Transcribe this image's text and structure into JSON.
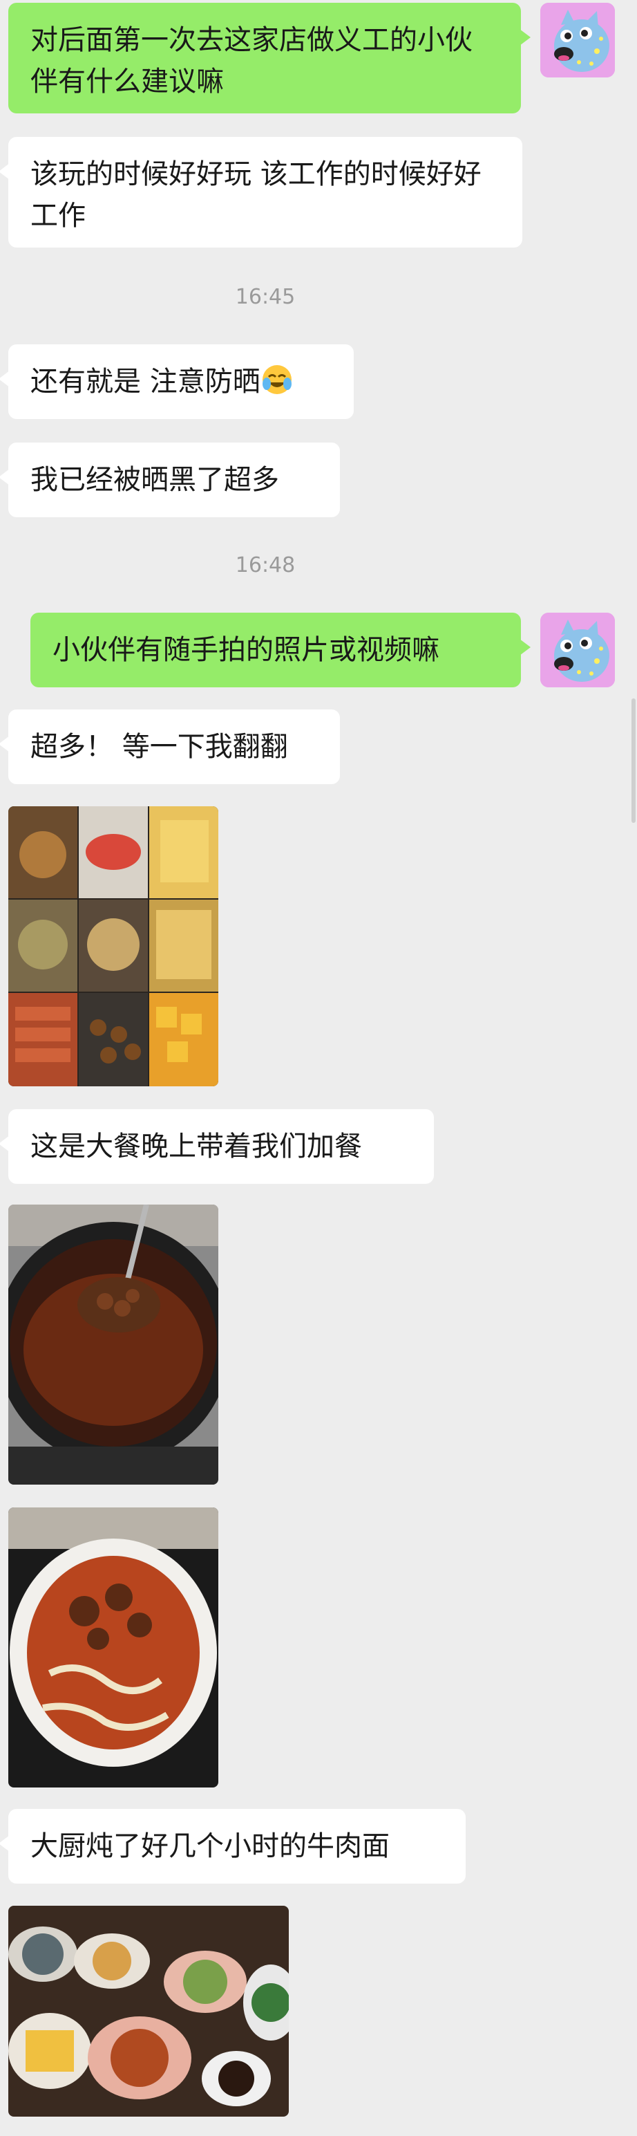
{
  "messages": [
    {
      "text": "对后面第一次去这家店做义工的小伙伴有什么建议嘛"
    },
    {
      "text": "该玩的时候好好玩  该工作的时候好好工作"
    },
    {
      "time": "16:45"
    },
    {
      "text": "还有就是 注意防晒"
    },
    {
      "text": "我已经被晒黑了超多"
    },
    {
      "time": "16:48"
    },
    {
      "text": "小伙伴有随手拍的照片或视频嘛"
    },
    {
      "text": "超多！ 等一下我翻翻"
    },
    {
      "text": "这是大餐晚上带着我们加餐"
    },
    {
      "text": "大厨炖了好几个小时的牛肉面"
    }
  ],
  "emoji": "laughing-with-tears-emoji",
  "colors": {
    "outgoing_bubble": "#95ec69",
    "incoming_bubble": "#ffffff",
    "background": "#ededed",
    "avatar_bg": "#e9a4e9"
  }
}
